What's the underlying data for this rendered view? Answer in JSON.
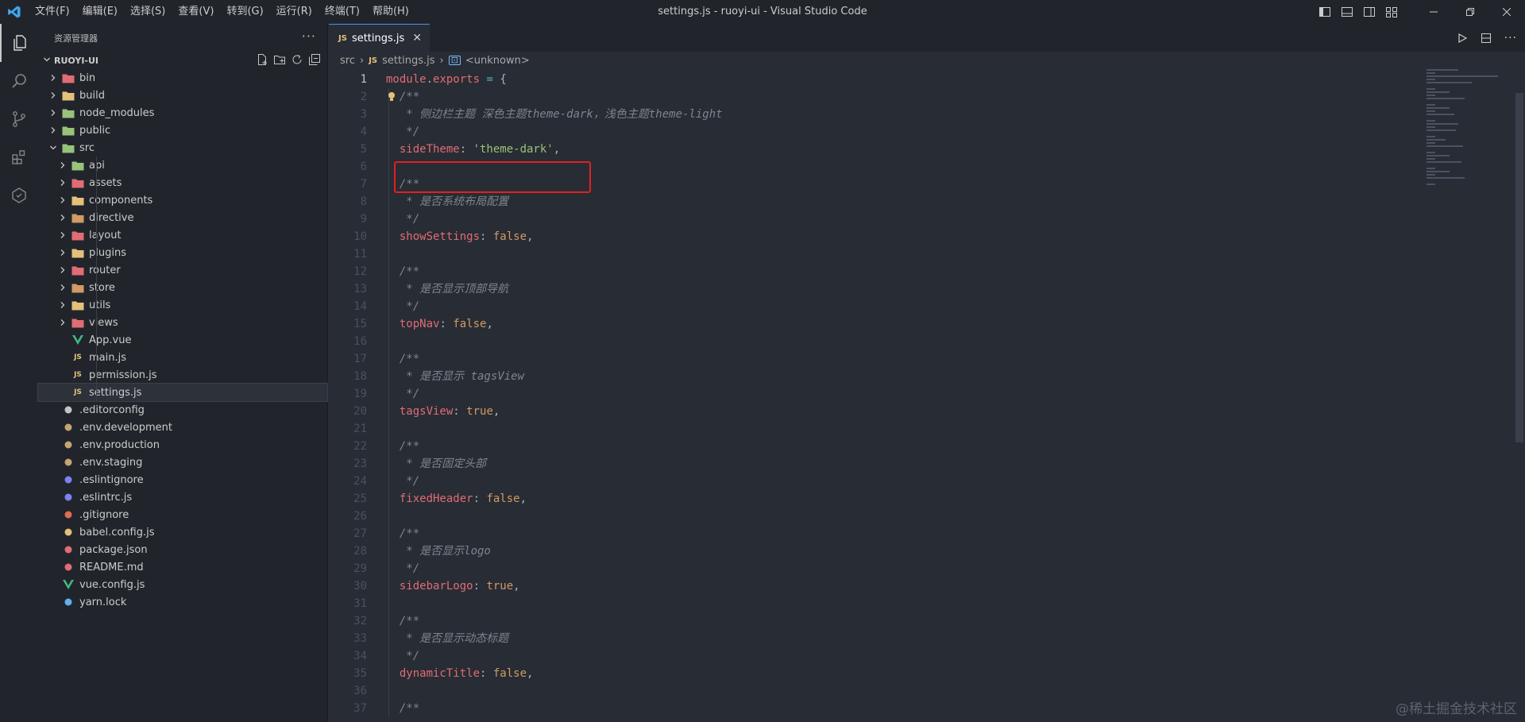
{
  "window": {
    "title": "settings.js - ruoyi-ui - Visual Studio Code",
    "menu": [
      "文件(F)",
      "编辑(E)",
      "选择(S)",
      "查看(V)",
      "转到(G)",
      "运行(R)",
      "终端(T)",
      "帮助(H)"
    ]
  },
  "colors": {
    "accent": "#528bff",
    "highlight": "#e02020",
    "background": "#282c34",
    "sidebar": "#21252b"
  },
  "activity_bar": [
    "files-icon",
    "search-icon",
    "source-control-icon",
    "extensions-icon",
    "remote-icon"
  ],
  "sidebar": {
    "title": "资源管理器",
    "more": "···",
    "project": "RUOYI-UI",
    "tree": [
      {
        "label": "bin",
        "depth": 0,
        "folder": true,
        "open": false,
        "icon": "folder-bin-icon",
        "color": "#e06c75"
      },
      {
        "label": "build",
        "depth": 0,
        "folder": true,
        "open": false,
        "icon": "folder-build-icon",
        "color": "#e5c07b"
      },
      {
        "label": "node_modules",
        "depth": 0,
        "folder": true,
        "open": false,
        "icon": "folder-node-icon",
        "color": "#98c379"
      },
      {
        "label": "public",
        "depth": 0,
        "folder": true,
        "open": false,
        "icon": "folder-public-icon",
        "color": "#98c379"
      },
      {
        "label": "src",
        "depth": 0,
        "folder": true,
        "open": true,
        "icon": "folder-src-icon",
        "color": "#98c379"
      },
      {
        "label": "api",
        "depth": 1,
        "folder": true,
        "open": false,
        "icon": "folder-api-icon",
        "color": "#98c379"
      },
      {
        "label": "assets",
        "depth": 1,
        "folder": true,
        "open": false,
        "icon": "folder-assets-icon",
        "color": "#e06c75"
      },
      {
        "label": "components",
        "depth": 1,
        "folder": true,
        "open": false,
        "icon": "folder-components-icon",
        "color": "#e5c07b"
      },
      {
        "label": "directive",
        "depth": 1,
        "folder": true,
        "open": false,
        "icon": "folder-icon",
        "color": "#d19a66"
      },
      {
        "label": "layout",
        "depth": 1,
        "folder": true,
        "open": false,
        "icon": "folder-layout-icon",
        "color": "#e06c75"
      },
      {
        "label": "plugins",
        "depth": 1,
        "folder": true,
        "open": false,
        "icon": "folder-plugins-icon",
        "color": "#e5c07b"
      },
      {
        "label": "router",
        "depth": 1,
        "folder": true,
        "open": false,
        "icon": "folder-router-icon",
        "color": "#e06c75"
      },
      {
        "label": "store",
        "depth": 1,
        "folder": true,
        "open": false,
        "icon": "folder-icon",
        "color": "#d19a66"
      },
      {
        "label": "utils",
        "depth": 1,
        "folder": true,
        "open": false,
        "icon": "folder-utils-icon",
        "color": "#e5c07b"
      },
      {
        "label": "views",
        "depth": 1,
        "folder": true,
        "open": false,
        "icon": "folder-views-icon",
        "color": "#e06c75"
      },
      {
        "label": "App.vue",
        "depth": 1,
        "folder": false,
        "icon": "vue-icon",
        "color": "#41b883"
      },
      {
        "label": "main.js",
        "depth": 1,
        "folder": false,
        "icon": "js-icon",
        "color": "#e5c07b"
      },
      {
        "label": "permission.js",
        "depth": 1,
        "folder": false,
        "icon": "js-icon",
        "color": "#e5c07b"
      },
      {
        "label": "settings.js",
        "depth": 1,
        "folder": false,
        "icon": "js-icon",
        "color": "#e5c07b",
        "selected": true
      },
      {
        "label": ".editorconfig",
        "depth": 0,
        "folder": false,
        "icon": "editorconfig-icon",
        "color": "#c5c5c5"
      },
      {
        "label": ".env.development",
        "depth": 0,
        "folder": false,
        "icon": "env-icon",
        "color": "#c5a572"
      },
      {
        "label": ".env.production",
        "depth": 0,
        "folder": false,
        "icon": "env-icon",
        "color": "#c5a572"
      },
      {
        "label": ".env.staging",
        "depth": 0,
        "folder": false,
        "icon": "env-icon",
        "color": "#c5a572"
      },
      {
        "label": ".eslintignore",
        "depth": 0,
        "folder": false,
        "icon": "eslint-icon",
        "color": "#8080f2"
      },
      {
        "label": ".eslintrc.js",
        "depth": 0,
        "folder": false,
        "icon": "eslint-icon",
        "color": "#8080f2"
      },
      {
        "label": ".gitignore",
        "depth": 0,
        "folder": false,
        "icon": "git-icon",
        "color": "#e06c50"
      },
      {
        "label": "babel.config.js",
        "depth": 0,
        "folder": false,
        "icon": "babel-icon",
        "color": "#e5c07b"
      },
      {
        "label": "package.json",
        "depth": 0,
        "folder": false,
        "icon": "npm-icon",
        "color": "#e06c75"
      },
      {
        "label": "README.md",
        "depth": 0,
        "folder": false,
        "icon": "markdown-icon",
        "color": "#e06c75"
      },
      {
        "label": "vue.config.js",
        "depth": 0,
        "folder": false,
        "icon": "vue-icon",
        "color": "#41b883"
      },
      {
        "label": "yarn.lock",
        "depth": 0,
        "folder": false,
        "icon": "yarn-icon",
        "color": "#61afef"
      }
    ]
  },
  "editor": {
    "tab": {
      "label": "settings.js",
      "close": "✕"
    },
    "breadcrumb": [
      "src",
      "settings.js",
      "<unknown>"
    ],
    "current_line": 1,
    "lines": [
      [
        [
          "module",
          "var"
        ],
        [
          ".",
          "punc"
        ],
        [
          "exports",
          "var"
        ],
        [
          " = ",
          "op"
        ],
        [
          "{",
          "punc"
        ]
      ],
      [
        [
          "  /**",
          "com"
        ]
      ],
      [
        [
          "   * 侧边栏主题 深色主题theme-dark，浅色主题theme-light",
          "com"
        ]
      ],
      [
        [
          "   */",
          "com"
        ]
      ],
      [
        [
          "  sideTheme",
          "key"
        ],
        [
          ": ",
          "punc"
        ],
        [
          "'theme-dark'",
          "str"
        ],
        [
          ",",
          "punc"
        ]
      ],
      [],
      [
        [
          "  /**",
          "com"
        ]
      ],
      [
        [
          "   * 是否系统布局配置",
          "com"
        ]
      ],
      [
        [
          "   */",
          "com"
        ]
      ],
      [
        [
          "  showSettings",
          "key"
        ],
        [
          ": ",
          "punc"
        ],
        [
          "false",
          "const"
        ],
        [
          ",",
          "punc"
        ]
      ],
      [],
      [
        [
          "  /**",
          "com"
        ]
      ],
      [
        [
          "   * 是否显示顶部导航",
          "com"
        ]
      ],
      [
        [
          "   */",
          "com"
        ]
      ],
      [
        [
          "  topNav",
          "key"
        ],
        [
          ": ",
          "punc"
        ],
        [
          "false",
          "const"
        ],
        [
          ",",
          "punc"
        ]
      ],
      [],
      [
        [
          "  /**",
          "com"
        ]
      ],
      [
        [
          "   * 是否显示 tagsView",
          "com"
        ]
      ],
      [
        [
          "   */",
          "com"
        ]
      ],
      [
        [
          "  tagsView",
          "key"
        ],
        [
          ": ",
          "punc"
        ],
        [
          "true",
          "const"
        ],
        [
          ",",
          "punc"
        ]
      ],
      [],
      [
        [
          "  /**",
          "com"
        ]
      ],
      [
        [
          "   * 是否固定头部",
          "com"
        ]
      ],
      [
        [
          "   */",
          "com"
        ]
      ],
      [
        [
          "  fixedHeader",
          "key"
        ],
        [
          ": ",
          "punc"
        ],
        [
          "false",
          "const"
        ],
        [
          ",",
          "punc"
        ]
      ],
      [],
      [
        [
          "  /**",
          "com"
        ]
      ],
      [
        [
          "   * 是否显示logo",
          "com"
        ]
      ],
      [
        [
          "   */",
          "com"
        ]
      ],
      [
        [
          "  sidebarLogo",
          "key"
        ],
        [
          ": ",
          "punc"
        ],
        [
          "true",
          "const"
        ],
        [
          ",",
          "punc"
        ]
      ],
      [],
      [
        [
          "  /**",
          "com"
        ]
      ],
      [
        [
          "   * 是否显示动态标题",
          "com"
        ]
      ],
      [
        [
          "   */",
          "com"
        ]
      ],
      [
        [
          "  dynamicTitle",
          "key"
        ],
        [
          ": ",
          "punc"
        ],
        [
          "false",
          "const"
        ],
        [
          ",",
          "punc"
        ]
      ],
      [],
      [
        [
          "  /**",
          "com"
        ]
      ]
    ]
  },
  "watermark": "@稀土掘金技术社区"
}
